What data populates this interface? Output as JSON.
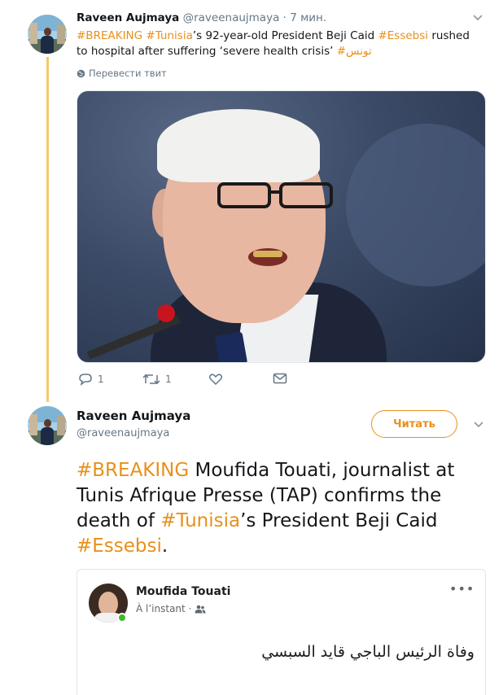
{
  "tweet1": {
    "name": "Raveen Aujmaya",
    "handle": "@raveenaujmaya",
    "time": "· 7 мин.",
    "text": {
      "tag_breaking": "#BREAKING",
      "tag_tunisia": "#Tunisia",
      "part1": "’s 92-year-old President Beji Caid ",
      "tag_essebsi": "#Essebsi",
      "part2": " rushed to hospital after suffering ‘severe health crisis’ ",
      "tag_tunis_ar": "#تونس"
    },
    "translate_label": "Перевести твит",
    "actions": {
      "reply_count": "1",
      "retweet_count": "1"
    }
  },
  "tweet2": {
    "name": "Raveen Aujmaya",
    "handle": "@raveenaujmaya",
    "follow_label": "Читать",
    "text": {
      "tag_breaking": "#BREAKING",
      "part1": " Moufida Touati, journalist at Tunis Afrique Presse (TAP) confirms the death of ",
      "tag_tunisia": "#Tunisia",
      "part2": "’s President Beji Caid ",
      "tag_essebsi": "#Essebsi",
      "part3": "."
    },
    "embedded_post": {
      "author": "Moufida Touati",
      "time": "À l’instant ·",
      "text": "وفاة الرئيس الباجي قايد السبسي"
    }
  },
  "colors": {
    "accent": "#e8901b",
    "thread_line": "#f9c868",
    "muted": "#657786"
  },
  "icons": [
    "caret-down-icon",
    "globe-icon",
    "reply-icon",
    "retweet-icon",
    "like-icon",
    "dm-icon",
    "more-icon",
    "audience-friends-icon"
  ]
}
